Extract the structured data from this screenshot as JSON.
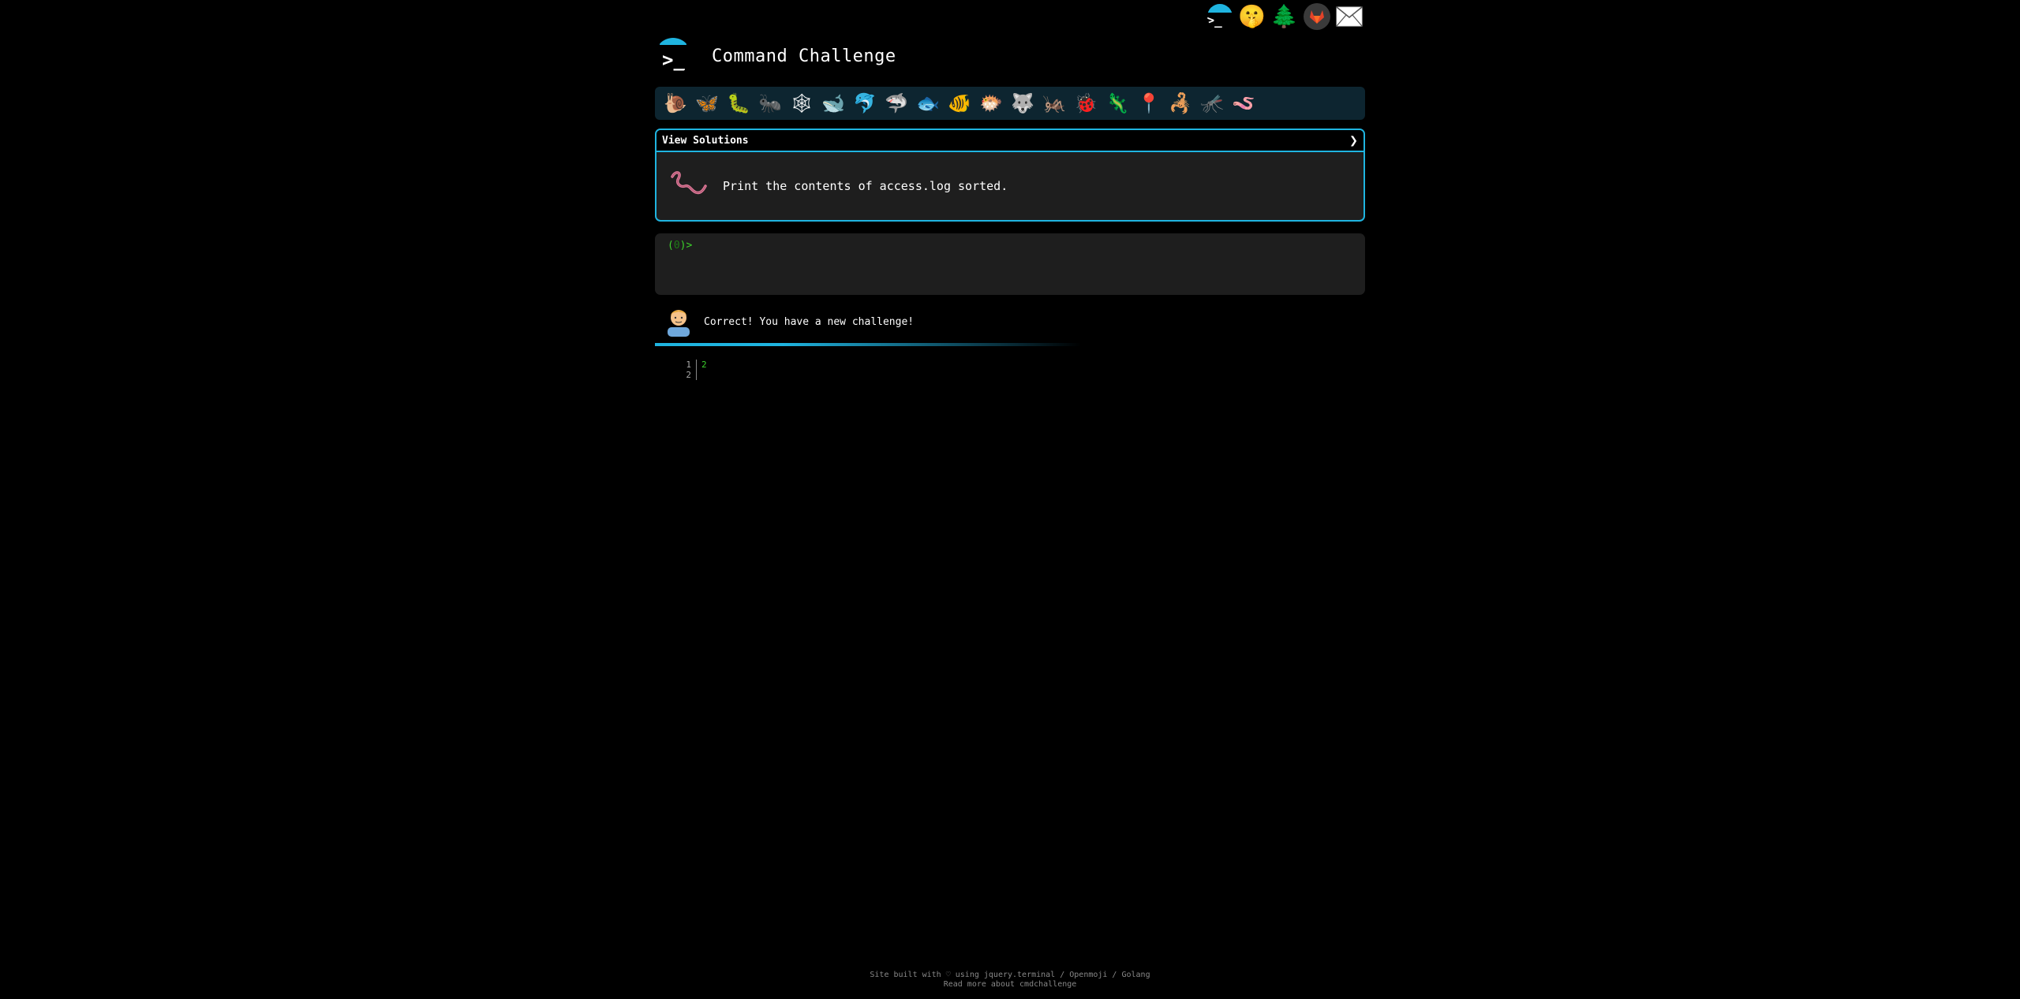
{
  "nav": {
    "icons": [
      "terminal-icon",
      "shushing-face-icon",
      "tree-icon",
      "gitlab-icon",
      "mail-icon"
    ]
  },
  "header": {
    "title": "Command Challenge"
  },
  "challenges": {
    "icons": [
      "🐌",
      "🦋",
      "🐛",
      "🐜",
      "🕸",
      "🐋",
      "🐬",
      "🦈",
      "🐟",
      "🐠",
      "🐡",
      "🐺",
      "🦗",
      "🐞",
      "🦎",
      "📍",
      "🦂",
      "🦟",
      "🪱"
    ]
  },
  "solution": {
    "header_label": "View Solutions",
    "task": "Print the contents of access.log sorted."
  },
  "terminal": {
    "prompt_open": "(",
    "prompt_mid": "0",
    "prompt_close": ")>"
  },
  "feedback": {
    "message": "Correct! You have a new challenge!"
  },
  "output": {
    "lines": [
      {
        "no": "1",
        "val": "2"
      },
      {
        "no": "2",
        "val": ""
      }
    ]
  },
  "footer": {
    "line1": "Site built with ♡ using jquery.terminal / Openmoji / Golang",
    "line2": "Read more about cmdchallenge"
  },
  "colors": {
    "accent": "#1fb4e0",
    "prompt_green": "#3cd12b",
    "panel": "#1e1e1e",
    "bar": "#0d2530"
  }
}
